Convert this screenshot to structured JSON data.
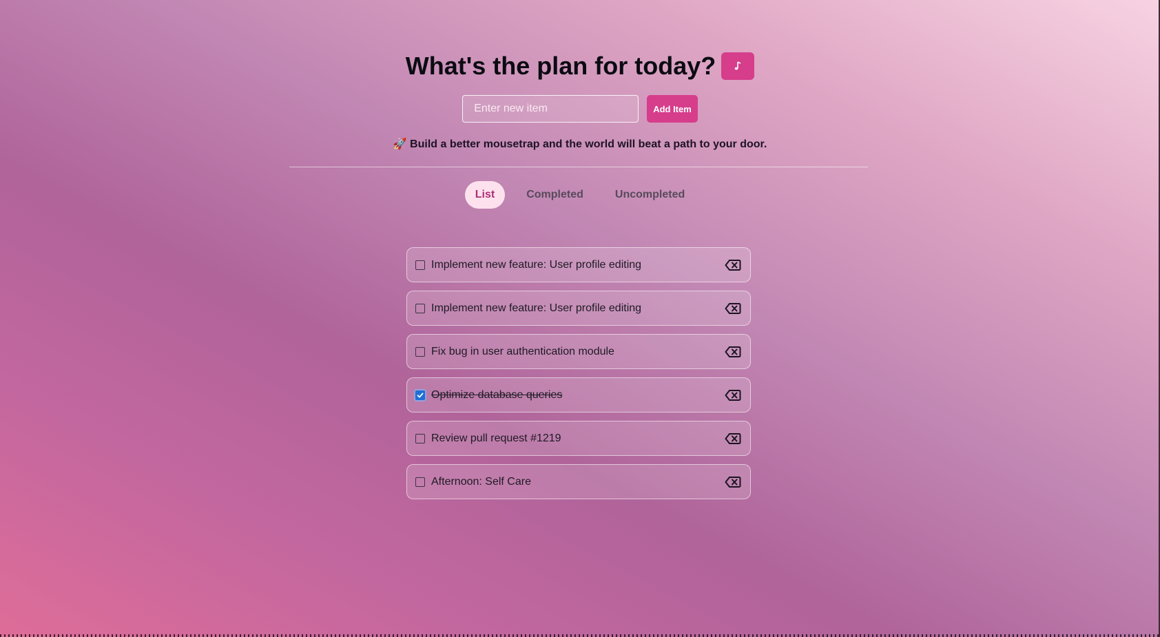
{
  "header": {
    "title": "What's the plan for today?",
    "music_icon": "music-note-icon"
  },
  "new_item": {
    "placeholder": "Enter new item",
    "value": "",
    "add_label": "Add Item"
  },
  "quote": {
    "emoji": "🚀",
    "text": "Build a better mousetrap and the world will beat a path to your door."
  },
  "tabs": [
    {
      "label": "List",
      "active": true
    },
    {
      "label": "Completed",
      "active": false
    },
    {
      "label": "Uncompleted",
      "active": false
    }
  ],
  "items": [
    {
      "label": "Implement new feature: User profile editing",
      "completed": false
    },
    {
      "label": "Implement new feature: User profile editing",
      "completed": false
    },
    {
      "label": "Fix bug in user authentication module",
      "completed": false
    },
    {
      "label": "Optimize database queries",
      "completed": true
    },
    {
      "label": "Review pull request #1219",
      "completed": false
    },
    {
      "label": "Afternoon: Self Care",
      "completed": false
    }
  ],
  "colors": {
    "accent": "#d63d8b",
    "active_tab_bg": "#fde2ee",
    "active_tab_text": "#b02d74",
    "checkbox_checked": "#1f6fd4"
  }
}
